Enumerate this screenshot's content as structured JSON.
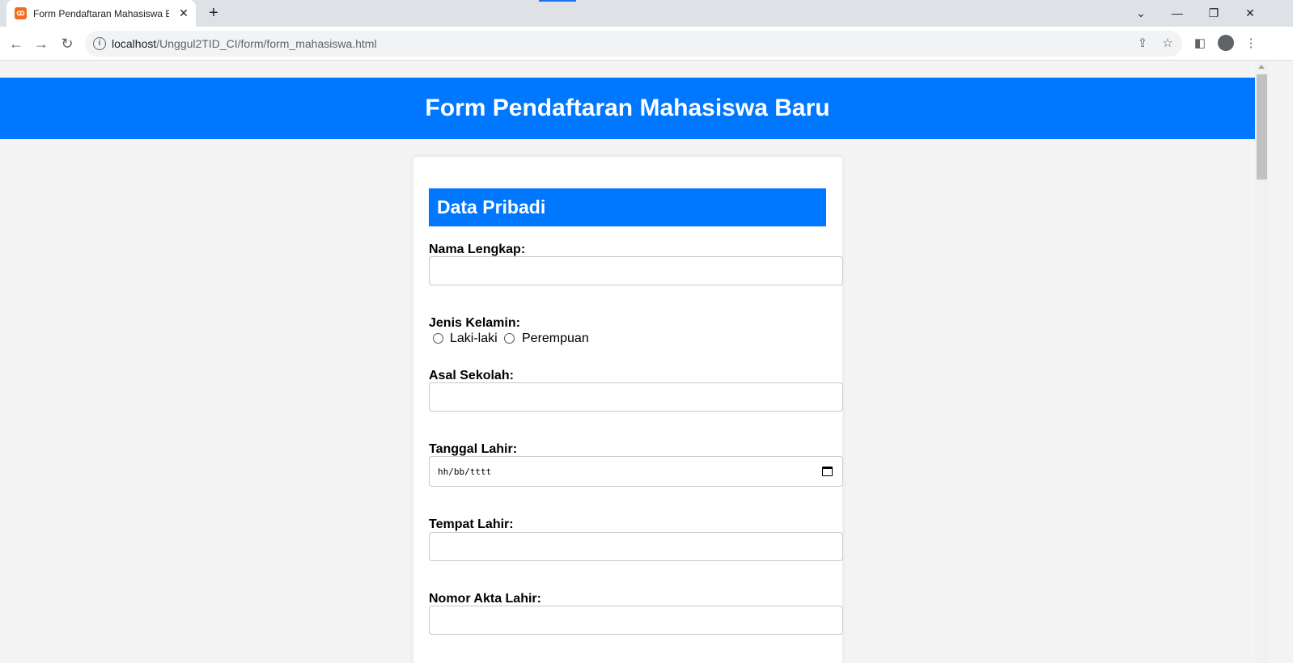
{
  "browser": {
    "tab_title": "Form Pendaftaran Mahasiswa Baru",
    "url_host": "localhost",
    "url_path": "/Unggul2TID_CI/form/form_mahasiswa.html"
  },
  "page": {
    "header_title": "Form Pendaftaran Mahasiswa Baru",
    "section_title": "Data Pribadi",
    "fields": {
      "nama_label": "Nama Lengkap:",
      "nama_value": "",
      "gender_label": "Jenis Kelamin:",
      "gender_options": [
        "Laki-laki",
        "Perempuan"
      ],
      "sekolah_label": "Asal Sekolah:",
      "sekolah_value": "",
      "tanggal_label": "Tanggal Lahir:",
      "tanggal_placeholder": "hh/bb/tttt",
      "tempat_label": "Tempat Lahir:",
      "tempat_value": "",
      "akta_label": "Nomor Akta Lahir:",
      "akta_value": ""
    }
  },
  "colors": {
    "accent": "#0077ff",
    "page_bg": "#f4f4f4"
  }
}
